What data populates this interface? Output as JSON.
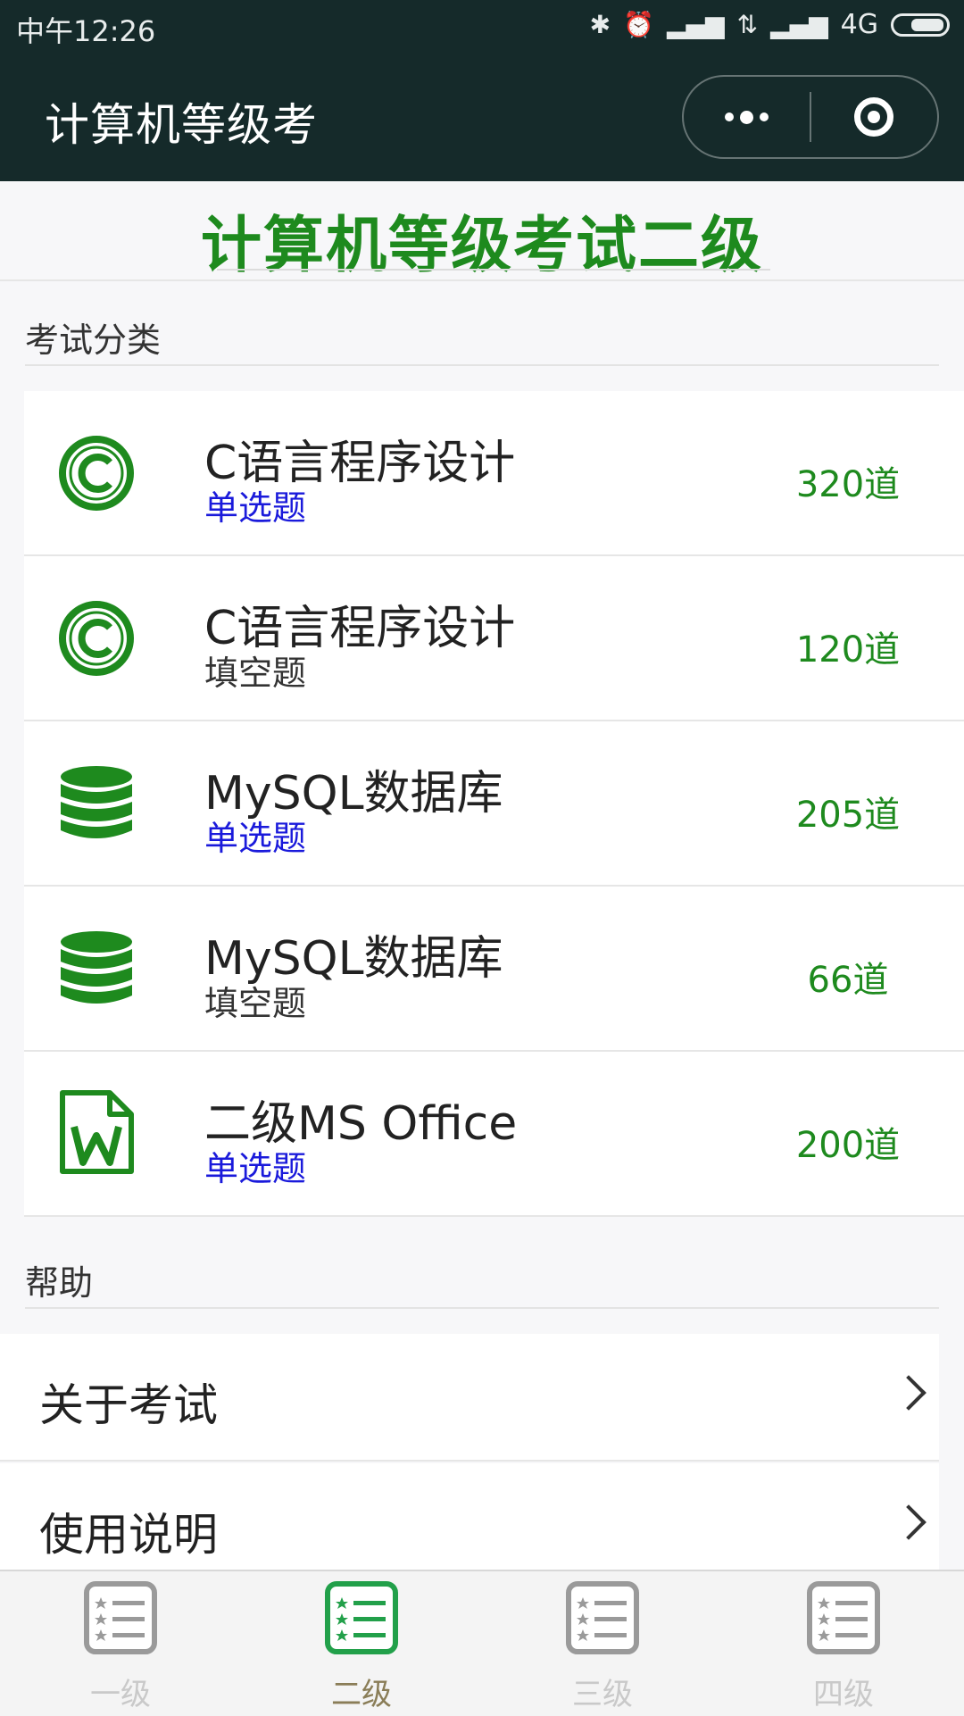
{
  "status_bar": {
    "time": "中午12:26",
    "network": "4G"
  },
  "app": {
    "title": "计算机等级考"
  },
  "page": {
    "heading": "计算机等级考试二级"
  },
  "category_section": {
    "title": "考试分类",
    "items": [
      {
        "name": "C语言程序设计",
        "type": "单选题",
        "type_color": "#1a1adb",
        "count": "320道",
        "icon": "copyright-icon"
      },
      {
        "name": "C语言程序设计",
        "type": "填空题",
        "type_color": "#333333",
        "count": "120道",
        "icon": "copyright-icon"
      },
      {
        "name": "MySQL数据库",
        "type": "单选题",
        "type_color": "#1a1adb",
        "count": "205道",
        "icon": "database-icon"
      },
      {
        "name": "MySQL数据库",
        "type": "填空题",
        "type_color": "#333333",
        "count": "66道",
        "icon": "database-icon"
      },
      {
        "name": "二级MS Office",
        "type": "单选题",
        "type_color": "#1a1adb",
        "count": "200道",
        "icon": "word-document-icon"
      }
    ]
  },
  "help_section": {
    "title": "帮助",
    "items": [
      {
        "label": "关于考试"
      },
      {
        "label": "使用说明"
      }
    ]
  },
  "tabbar": {
    "items": [
      {
        "label": "一级",
        "active": false
      },
      {
        "label": "二级",
        "active": true
      },
      {
        "label": "三级",
        "active": false
      },
      {
        "label": "四级",
        "active": false
      }
    ]
  },
  "colors": {
    "header_bg": "#152a2a",
    "accent_green": "#1e8a1e",
    "tab_active_label": "#8a7d57"
  }
}
